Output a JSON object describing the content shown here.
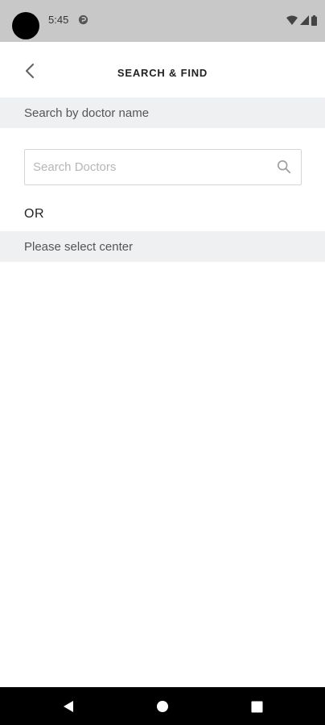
{
  "status_bar": {
    "time": "5:45",
    "icons": [
      "app-notification-icon",
      "wifi-icon",
      "cell-signal-icon",
      "battery-icon"
    ]
  },
  "header": {
    "title": "SEARCH & FIND",
    "back_icon": "chevron-left-icon"
  },
  "search_by_doctor": {
    "label": "Search by doctor name",
    "input_placeholder": "Search Doctors",
    "input_value": ""
  },
  "divider_text": "OR",
  "select_center": {
    "label": "Please select center"
  },
  "nav_bar": {
    "buttons": [
      "back-triangle-icon",
      "home-circle-icon",
      "recents-square-icon"
    ]
  },
  "colors": {
    "status_bar_bg": "#c8c8c8",
    "section_bg": "#eff0f2",
    "nav_bar_bg": "#000000",
    "input_border": "#d4d6d9"
  }
}
